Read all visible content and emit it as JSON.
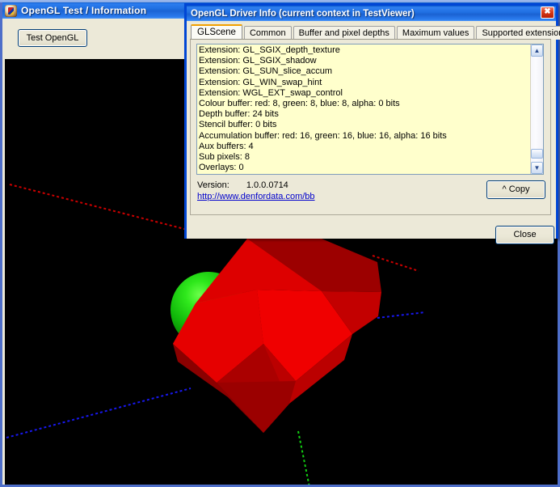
{
  "main_window": {
    "title": "OpenGL Test / Information",
    "icon": "opengl-app-icon",
    "toolbar": {
      "test_button_label": "Test OpenGL"
    },
    "viewport": {
      "name": "opengl-3d-viewport",
      "background_color": "#000000",
      "objects": [
        {
          "name": "sphere",
          "color": "#00cc00",
          "highlight_color": "#33ff33"
        },
        {
          "name": "polyhedron",
          "color": "#ee0000",
          "shade_colors": [
            "#ff0000",
            "#cc0000",
            "#aa0000",
            "#8b0000"
          ]
        }
      ],
      "axes": [
        {
          "name": "x-axis",
          "color": "#ff0000",
          "style": "dotted"
        },
        {
          "name": "y-axis",
          "color": "#00ff00",
          "style": "dotted"
        },
        {
          "name": "z-axis",
          "color": "#0000ff",
          "style": "dotted"
        }
      ]
    }
  },
  "dialog": {
    "title": "OpenGL Driver Info (current context in TestViewer)",
    "close_glyph": "✖",
    "tabs": [
      {
        "label": "GLScene",
        "active": true
      },
      {
        "label": "Common",
        "active": false
      },
      {
        "label": "Buffer and pixel depths",
        "active": false
      },
      {
        "label": "Maximum values",
        "active": false
      },
      {
        "label": "Supported extensions",
        "active": false
      }
    ],
    "info_list": [
      "Extension: GL_SGIX_depth_texture",
      "Extension: GL_SGIX_shadow",
      "Extension: GL_SUN_slice_accum",
      "Extension: GL_WIN_swap_hint",
      "Extension: WGL_EXT_swap_control",
      "Colour buffer: red: 8,  green: 8,  blue: 8,  alpha: 0  bits",
      "Depth buffer: 24 bits",
      "Stencil buffer: 0 bits",
      "Accumulation buffer: red: 16,  green: 16,  blue: 16,  alpha: 16  bits",
      "Aux buffers: 4",
      "Sub pixels: 8",
      "Overlays: 0"
    ],
    "scrollbar": {
      "up_glyph": "▲",
      "down_glyph": "▼"
    },
    "version_label": "Version:",
    "version_value": "1.0.0.0714",
    "homepage_url": "http://www.denfordata.com/bb",
    "copy_button_label": "^ Copy",
    "close_button_label": "Close"
  },
  "colors": {
    "titlebar_blue": "#1f6ee0",
    "dialog_border": "#0046d5",
    "listbox_bg": "#ffffcc",
    "face_beige": "#ece9d8",
    "active_tab_accent": "#f0a000",
    "link_blue": "#0000cc"
  }
}
